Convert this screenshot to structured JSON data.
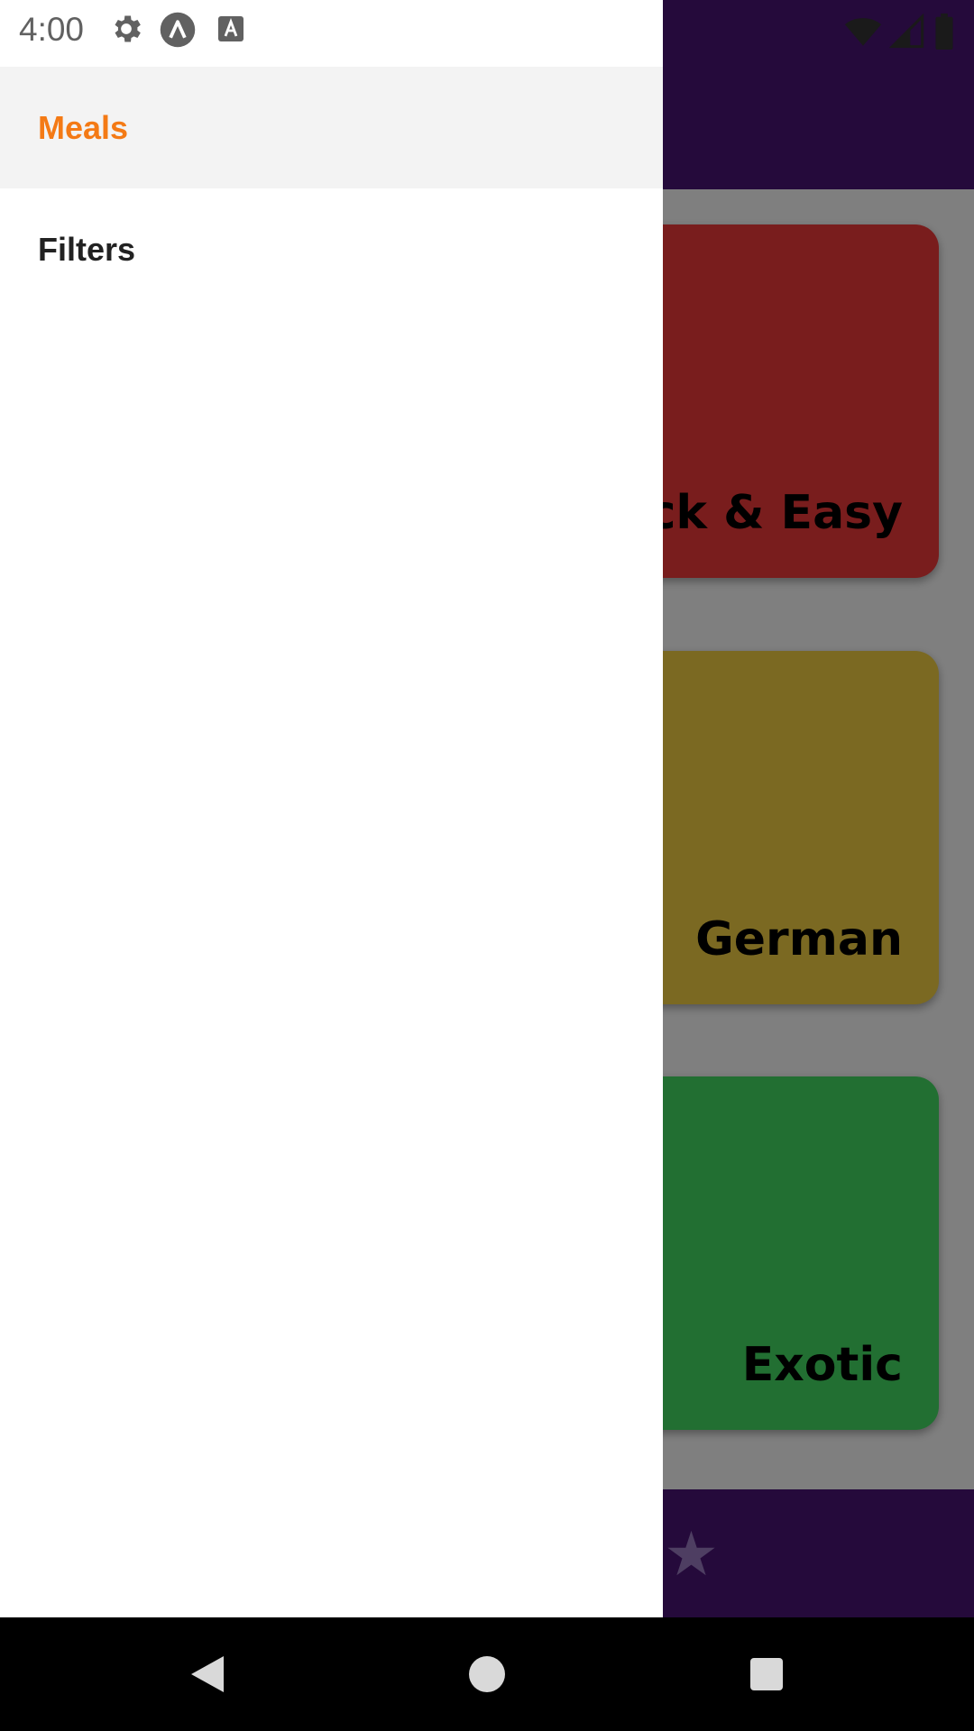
{
  "status_bar": {
    "time": "4:00",
    "left_icons": [
      "gear-icon",
      "lambda-icon",
      "a-box-icon"
    ],
    "right_icons": [
      "wifi-icon",
      "signal-icon",
      "battery-icon"
    ]
  },
  "drawer": {
    "items": [
      {
        "label": "Meals",
        "active": true
      },
      {
        "label": "Filters",
        "active": false
      }
    ],
    "active_color": "#f47a15"
  },
  "categories": [
    {
      "title": "Quick & Easy",
      "color": "#f23a3a"
    },
    {
      "title": "German",
      "color": "#f6d344"
    },
    {
      "title": "Exotic",
      "color": "#44df64"
    }
  ],
  "app": {
    "header_color": "#4a1577",
    "tab_icons": [
      "star-icon"
    ]
  },
  "nav_bar": {
    "buttons": [
      "back-icon",
      "home-icon",
      "recents-icon"
    ]
  }
}
